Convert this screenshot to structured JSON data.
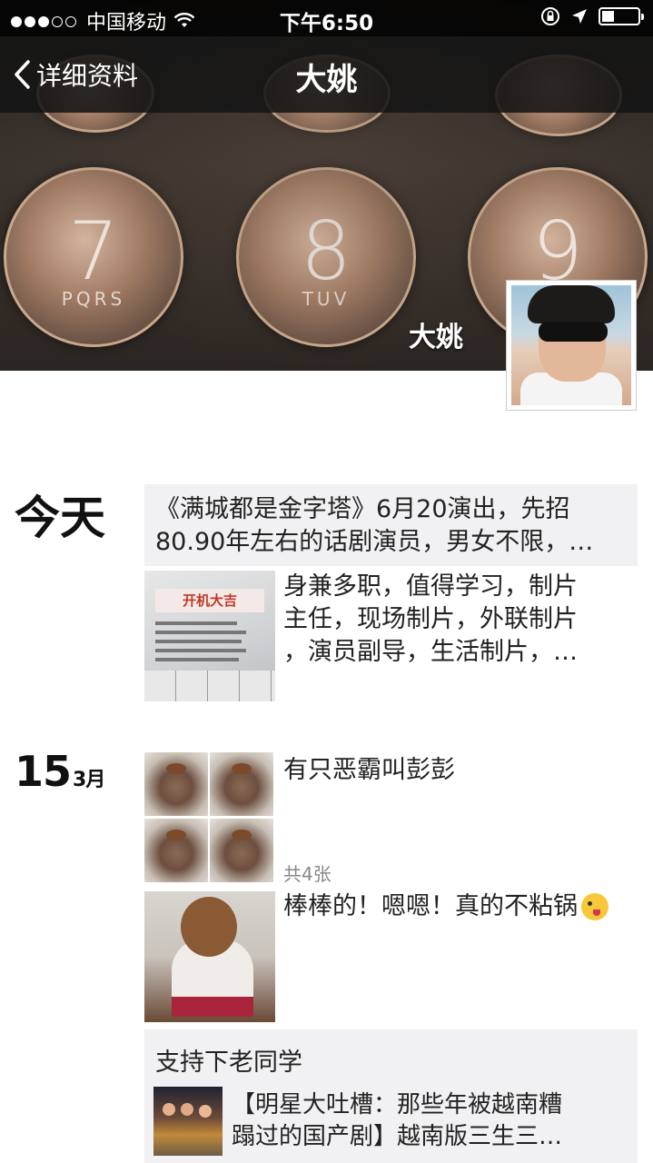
{
  "status_bar": {
    "carrier": "中国移动",
    "time": "下午6:50"
  },
  "nav": {
    "back_label": "详细资料",
    "title": "大姚"
  },
  "cover": {
    "keypad": [
      {
        "digit": "7",
        "letters": "PQRS"
      },
      {
        "digit": "8",
        "letters": "TUV"
      },
      {
        "digit": "9",
        "letters": ""
      }
    ],
    "name": "大姚"
  },
  "feed": {
    "today_label": "今天",
    "post1_lines": [
      "《满城都是金字塔》6月20演出，先招",
      "80.90年左右的话剧演员，男女不限，…"
    ],
    "post2_image_text": "开机大吉",
    "post2_lines": [
      "身兼多职，值得学习，制片",
      "主任，现场制片，外联制片",
      "，演员副导，生活制片，…"
    ],
    "date_day": "15",
    "date_month": "3月",
    "post3_text": "有只恶霸叫彭彭",
    "post3_count": "共4张",
    "post4_text": "棒棒的！嗯嗯！真的不粘锅",
    "share_caption": "支持下老同学",
    "share_title_lines": [
      "【明星大吐槽：那些年被越南糟",
      "蹋过的国产剧】越南版三生三…"
    ]
  }
}
